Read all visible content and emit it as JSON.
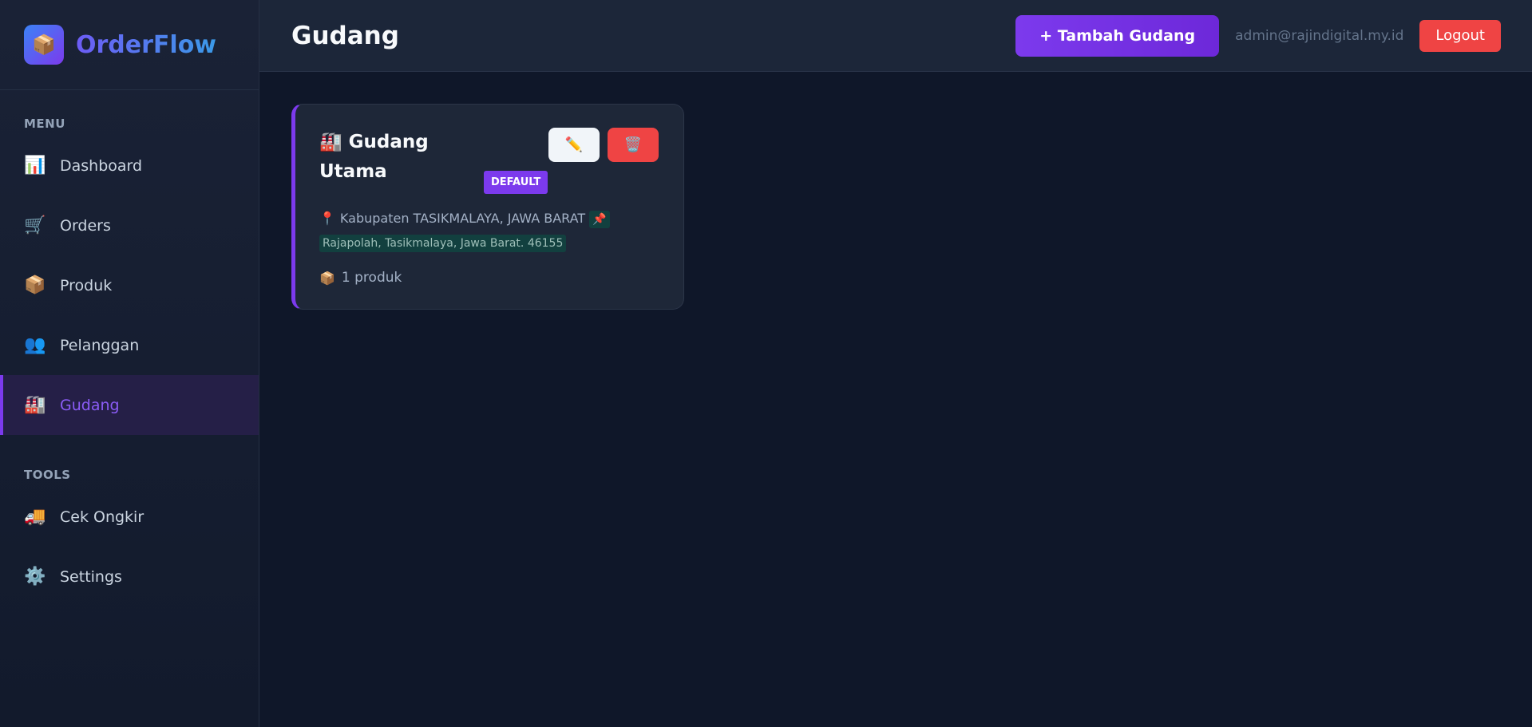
{
  "brand": {
    "logo_icon": "📦",
    "name": "OrderFlow"
  },
  "sidebar": {
    "menu_label": "MENU",
    "menu_items": [
      {
        "icon": "📊",
        "label": "Dashboard"
      },
      {
        "icon": "🛒",
        "label": "Orders"
      },
      {
        "icon": "📦",
        "label": "Produk"
      },
      {
        "icon": "👥",
        "label": "Pelanggan"
      },
      {
        "icon": "🏭",
        "label": "Gudang",
        "active": true
      }
    ],
    "tools_label": "TOOLS",
    "tool_items": [
      {
        "icon": "🚚",
        "label": "Cek Ongkir"
      },
      {
        "icon": "⚙️",
        "label": "Settings"
      }
    ]
  },
  "header": {
    "title": "Gudang",
    "add_button": "+ Tambah Gudang",
    "user_email": "admin@rajindigital.my.id",
    "logout_button": "Logout"
  },
  "warehouse_card": {
    "icon": "🏭",
    "name": "Gudang Utama",
    "badge": "DEFAULT",
    "edit_icon": "✏️",
    "delete_icon": "🗑️",
    "location_icon": "📍",
    "location": "Kabupaten TASIKMALAYA, JAWA BARAT",
    "address_icon": "📌",
    "address": "Rajapolah, Tasikmalaya, Jawa Barat. 46155",
    "product_icon": "📦",
    "product_count": "1 produk"
  },
  "colors": {
    "accent": "#7c3aed",
    "danger": "#ef4444",
    "background": "#0f1729",
    "sidebar": "#1a2236"
  }
}
